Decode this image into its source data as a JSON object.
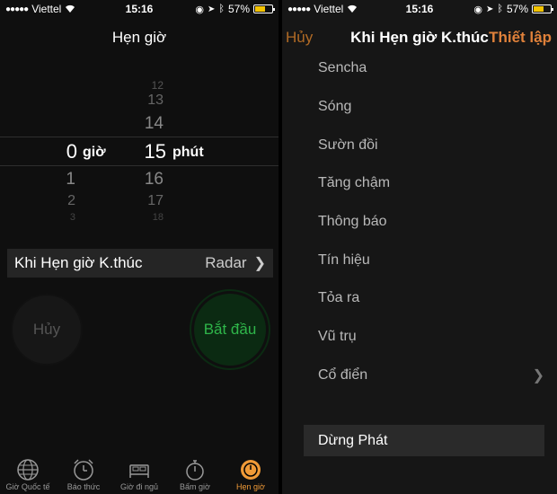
{
  "status_bar": {
    "carrier": "Viettel",
    "time": "15:16",
    "battery": "57%",
    "battery_level": 0.57
  },
  "timer_screen": {
    "title": "Hẹn giờ",
    "picker": {
      "hours_above": [],
      "hours_selected": "0",
      "hours_below": [
        "1",
        "2",
        "3"
      ],
      "hours_unit": "giờ",
      "minutes_above": [
        "12",
        "13",
        "14"
      ],
      "minutes_selected": "15",
      "minutes_below": [
        "16",
        "17",
        "18"
      ],
      "minutes_unit": "phút"
    },
    "ends_row": {
      "label": "Khi Hẹn giờ K.thúc",
      "value": "Radar"
    },
    "cancel_label": "Hủy",
    "start_label": "Bắt đầu",
    "tabs": [
      {
        "label": "Giờ Quốc tế",
        "icon": "globe-icon"
      },
      {
        "label": "Báo thức",
        "icon": "alarm-clock-icon"
      },
      {
        "label": "Giờ đi ngủ",
        "icon": "bed-icon"
      },
      {
        "label": "Bấm giờ",
        "icon": "stopwatch-icon"
      },
      {
        "label": "Hẹn giờ",
        "icon": "timer-icon"
      }
    ]
  },
  "tone_screen": {
    "cancel_label": "Hủy",
    "title": "Khi Hẹn giờ K.thúc",
    "set_label": "Thiết lập",
    "tones": [
      "Sencha",
      "Sóng",
      "Sườn đồi",
      "Tăng chậm",
      "Thông báo",
      "Tín hiệu",
      "Tỏa ra",
      "Vũ trụ",
      "Cổ điển"
    ],
    "stop_label": "Dừng Phát"
  },
  "colors": {
    "accent_orange": "#f09a37",
    "start_green": "#2fb64a",
    "battery_yellow": "#f4c400"
  }
}
